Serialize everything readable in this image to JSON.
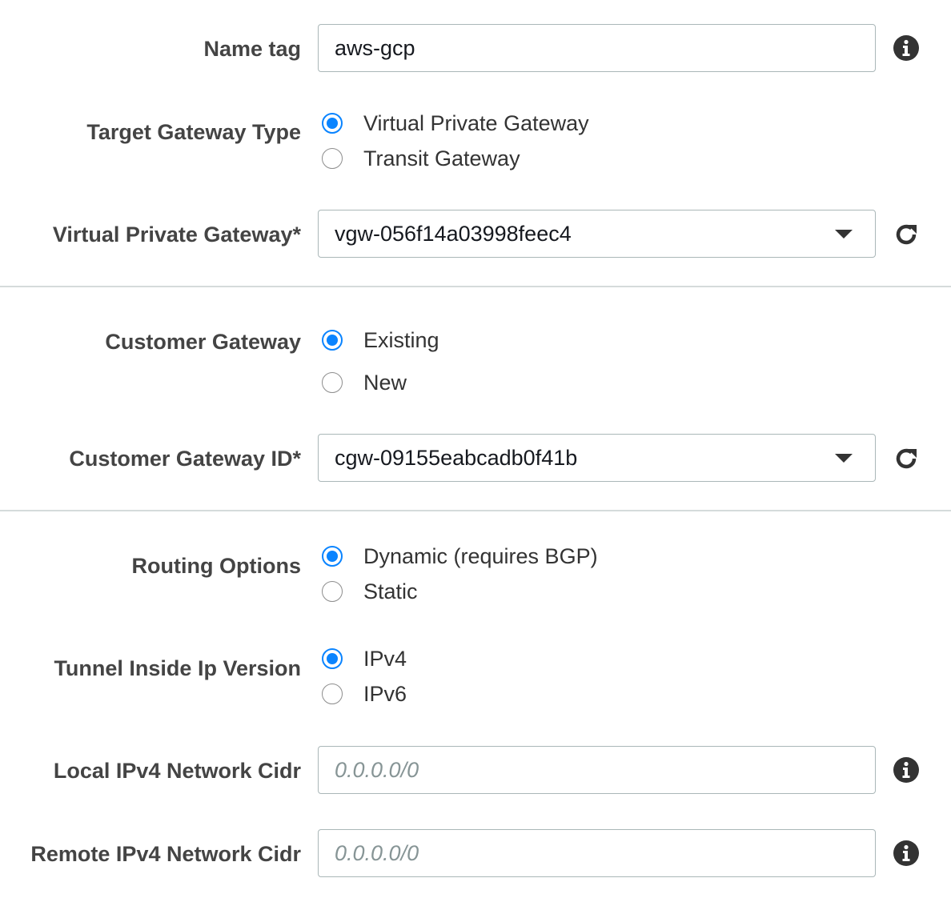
{
  "name_tag": {
    "label": "Name tag",
    "value": "aws-gcp"
  },
  "target_gateway_type": {
    "label": "Target Gateway Type",
    "options": [
      {
        "label": "Virtual Private Gateway",
        "selected": true
      },
      {
        "label": "Transit Gateway",
        "selected": false
      }
    ]
  },
  "virtual_private_gateway": {
    "label": "Virtual Private Gateway*",
    "value": "vgw-056f14a03998feec4"
  },
  "customer_gateway": {
    "label": "Customer Gateway",
    "options": [
      {
        "label": "Existing",
        "selected": true
      },
      {
        "label": "New",
        "selected": false
      }
    ]
  },
  "customer_gateway_id": {
    "label": "Customer Gateway ID*",
    "value": "cgw-09155eabcadb0f41b"
  },
  "routing_options": {
    "label": "Routing Options",
    "options": [
      {
        "label": "Dynamic (requires BGP)",
        "selected": true
      },
      {
        "label": "Static",
        "selected": false
      }
    ]
  },
  "tunnel_inside_ip_version": {
    "label": "Tunnel Inside Ip Version",
    "options": [
      {
        "label": "IPv4",
        "selected": true
      },
      {
        "label": "IPv6",
        "selected": false
      }
    ]
  },
  "local_ipv4_network_cidr": {
    "label": "Local IPv4 Network Cidr",
    "value": "",
    "placeholder": "0.0.0.0/0"
  },
  "remote_ipv4_network_cidr": {
    "label": "Remote IPv4 Network Cidr",
    "value": "",
    "placeholder": "0.0.0.0/0"
  },
  "icons": {
    "info": "info-icon",
    "refresh": "refresh-icon",
    "dropdown": "chevron-down-icon"
  },
  "colors": {
    "radio_selected": "#0a84ff",
    "label_text": "#444444",
    "border": "#aab7b8",
    "divider": "#d5dbdb"
  }
}
